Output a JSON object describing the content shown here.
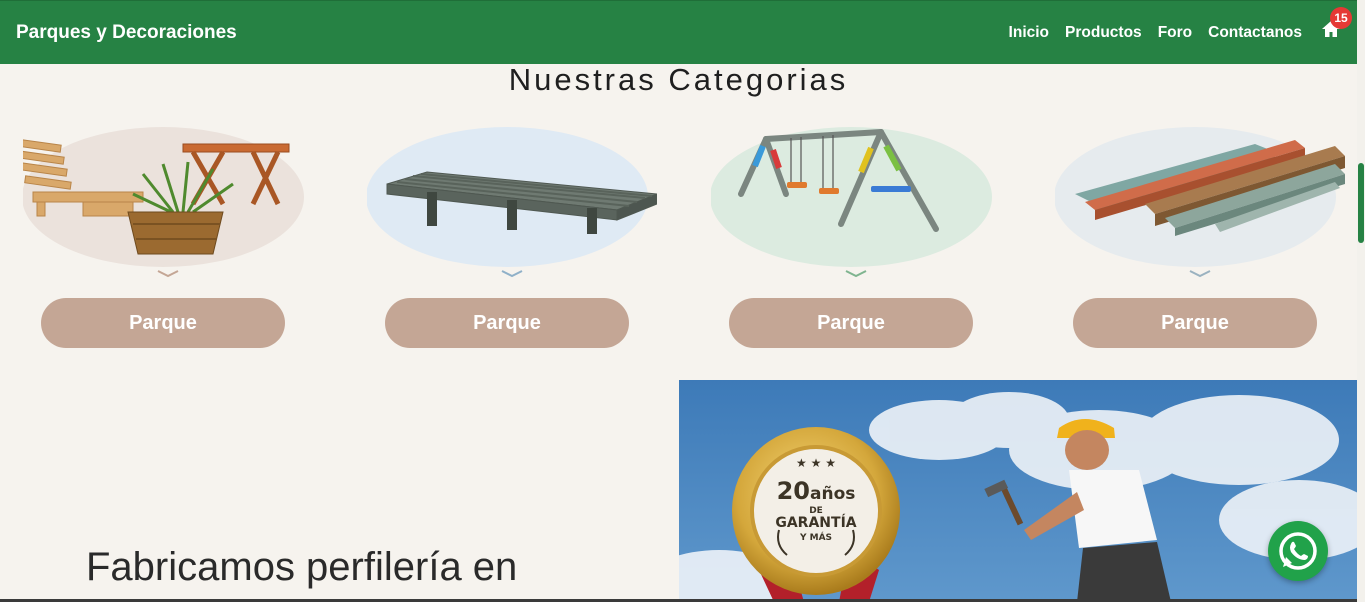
{
  "navbar": {
    "brand": "Parques y Decoraciones",
    "links": [
      "Inicio",
      "Productos",
      "Foro",
      "Contactanos"
    ],
    "cart_count": "15",
    "home_icon": "home-icon",
    "color": "#268244"
  },
  "categories": {
    "title": "Nuestras Categorias",
    "items": [
      {
        "button": "Parque",
        "image": "chair-table-plant"
      },
      {
        "button": "Parque",
        "image": "deck-pallet"
      },
      {
        "button": "Parque",
        "image": "swing-set"
      },
      {
        "button": "Parque",
        "image": "lumber-profiles"
      }
    ],
    "button_color": "#c4a695"
  },
  "feature": {
    "headline": "Fabricamos perfilería en",
    "seal": {
      "number": "20",
      "unit": "años",
      "line1": "DE",
      "line2": "GARANTÍA",
      "line3": "Y MÁS"
    }
  },
  "whatsapp": {
    "icon": "whatsapp-icon"
  }
}
